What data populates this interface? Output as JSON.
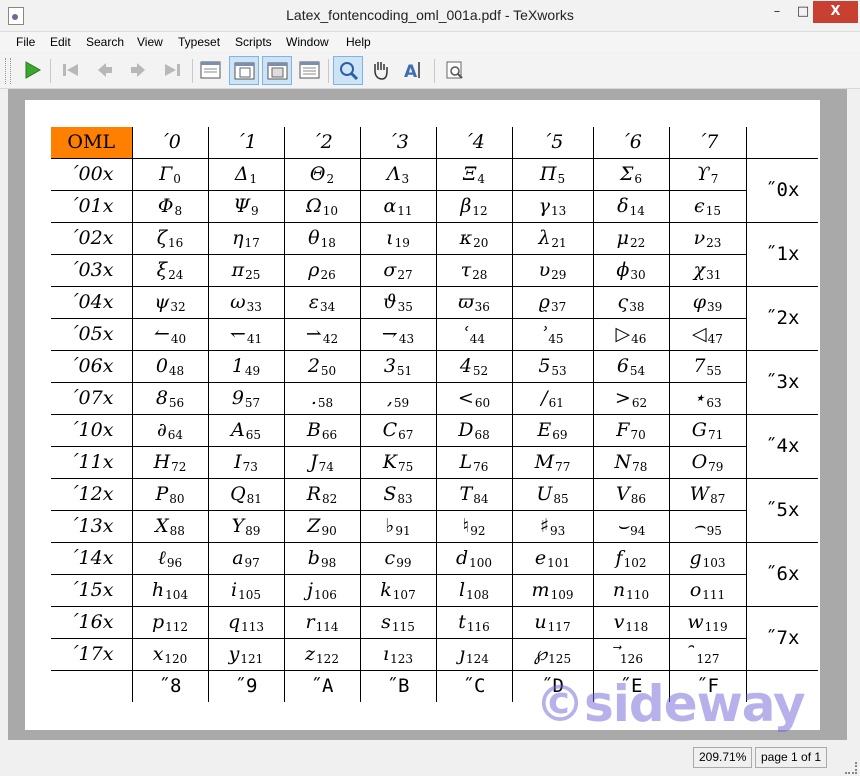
{
  "window": {
    "title": "Latex_fontencoding_oml_001a.pdf - TeXworks",
    "minimize": "–",
    "maximize": "□",
    "close": "X"
  },
  "menu": [
    "File",
    "Edit",
    "Search",
    "View",
    "Typeset",
    "Scripts",
    "Window",
    "Help"
  ],
  "toolbar": [
    {
      "name": "typeset-button",
      "icon": "play-icon",
      "active": false
    },
    {
      "name": "first-page-button",
      "icon": "first-page-icon",
      "active": false
    },
    {
      "name": "previous-page-button",
      "icon": "previous-page-icon",
      "active": false
    },
    {
      "name": "next-page-button",
      "icon": "next-page-icon",
      "active": false
    },
    {
      "name": "last-page-button",
      "icon": "last-page-icon",
      "active": false
    },
    {
      "name": "actual-size-button",
      "icon": "actual-size-icon",
      "active": false
    },
    {
      "name": "fit-width-button",
      "icon": "fit-width-icon",
      "active": true
    },
    {
      "name": "fit-window-button",
      "icon": "fit-window-icon",
      "active": true
    },
    {
      "name": "continuous-scroll-button",
      "icon": "continuous-scroll-icon",
      "active": false
    },
    {
      "name": "magnify-tool-button",
      "icon": "magnifier-icon",
      "active": true
    },
    {
      "name": "scroll-tool-button",
      "icon": "hand-icon",
      "active": false
    },
    {
      "name": "select-text-tool-button",
      "icon": "select-text-icon",
      "active": false
    },
    {
      "name": "select-image-tool-button",
      "icon": "select-image-icon",
      "active": false
    }
  ],
  "table": {
    "corner": "OML",
    "columns": [
      "´0",
      "´1",
      "´2",
      "´3",
      "´4",
      "´5",
      "´6",
      "´7"
    ],
    "footer": [
      "˝8",
      "˝9",
      "˝A",
      "˝B",
      "˝C",
      "˝D",
      "˝E",
      "˝F"
    ],
    "hex_groups": [
      "˝0x",
      "˝1x",
      "˝2x",
      "˝3x",
      "˝4x",
      "˝5x",
      "˝6x",
      "˝7x"
    ],
    "rows": [
      {
        "label": "´00x",
        "cells": [
          {
            "g": "Γ",
            "n": "0"
          },
          {
            "g": "Δ",
            "n": "1"
          },
          {
            "g": "Θ",
            "n": "2"
          },
          {
            "g": "Λ",
            "n": "3"
          },
          {
            "g": "Ξ",
            "n": "4"
          },
          {
            "g": "Π",
            "n": "5"
          },
          {
            "g": "Σ",
            "n": "6"
          },
          {
            "g": "ϒ",
            "n": "7"
          }
        ]
      },
      {
        "label": "´01x",
        "cells": [
          {
            "g": "Φ",
            "n": "8"
          },
          {
            "g": "Ψ",
            "n": "9"
          },
          {
            "g": "Ω",
            "n": "10"
          },
          {
            "g": "α",
            "n": "11"
          },
          {
            "g": "β",
            "n": "12"
          },
          {
            "g": "γ",
            "n": "13"
          },
          {
            "g": "δ",
            "n": "14"
          },
          {
            "g": "ϵ",
            "n": "15"
          }
        ]
      },
      {
        "label": "´02x",
        "cells": [
          {
            "g": "ζ",
            "n": "16"
          },
          {
            "g": "η",
            "n": "17"
          },
          {
            "g": "θ",
            "n": "18"
          },
          {
            "g": "ι",
            "n": "19"
          },
          {
            "g": "κ",
            "n": "20"
          },
          {
            "g": "λ",
            "n": "21"
          },
          {
            "g": "μ",
            "n": "22"
          },
          {
            "g": "ν",
            "n": "23"
          }
        ]
      },
      {
        "label": "´03x",
        "cells": [
          {
            "g": "ξ",
            "n": "24"
          },
          {
            "g": "π",
            "n": "25"
          },
          {
            "g": "ρ",
            "n": "26"
          },
          {
            "g": "σ",
            "n": "27"
          },
          {
            "g": "τ",
            "n": "28"
          },
          {
            "g": "υ",
            "n": "29"
          },
          {
            "g": "ϕ",
            "n": "30"
          },
          {
            "g": "χ",
            "n": "31"
          }
        ]
      },
      {
        "label": "´04x",
        "cells": [
          {
            "g": "ψ",
            "n": "32"
          },
          {
            "g": "ω",
            "n": "33"
          },
          {
            "g": "ε",
            "n": "34"
          },
          {
            "g": "ϑ",
            "n": "35"
          },
          {
            "g": "ϖ",
            "n": "36"
          },
          {
            "g": "ϱ",
            "n": "37"
          },
          {
            "g": "ς",
            "n": "38"
          },
          {
            "g": "φ",
            "n": "39"
          }
        ]
      },
      {
        "label": "´05x",
        "cells": [
          {
            "g": "↼",
            "n": "40"
          },
          {
            "g": "↽",
            "n": "41"
          },
          {
            "g": "⇀",
            "n": "42"
          },
          {
            "g": "⇁",
            "n": "43"
          },
          {
            "g": "ʿ",
            "n": "44"
          },
          {
            "g": "ʾ",
            "n": "45"
          },
          {
            "g": "▷",
            "n": "46"
          },
          {
            "g": "◁",
            "n": "47"
          }
        ]
      },
      {
        "label": "´06x",
        "cells": [
          {
            "g": "0",
            "n": "48"
          },
          {
            "g": "1",
            "n": "49"
          },
          {
            "g": "2",
            "n": "50"
          },
          {
            "g": "3",
            "n": "51"
          },
          {
            "g": "4",
            "n": "52"
          },
          {
            "g": "5",
            "n": "53"
          },
          {
            "g": "6",
            "n": "54"
          },
          {
            "g": "7",
            "n": "55"
          }
        ]
      },
      {
        "label": "´07x",
        "cells": [
          {
            "g": "8",
            "n": "56"
          },
          {
            "g": "9",
            "n": "57"
          },
          {
            "g": ".",
            "n": "58"
          },
          {
            "g": ",",
            "n": "59"
          },
          {
            "g": "<",
            "n": "60"
          },
          {
            "g": "/",
            "n": "61"
          },
          {
            "g": ">",
            "n": "62"
          },
          {
            "g": "⋆",
            "n": "63"
          }
        ]
      },
      {
        "label": "´10x",
        "cells": [
          {
            "g": "∂",
            "n": "64"
          },
          {
            "g": "A",
            "n": "65"
          },
          {
            "g": "B",
            "n": "66"
          },
          {
            "g": "C",
            "n": "67"
          },
          {
            "g": "D",
            "n": "68"
          },
          {
            "g": "E",
            "n": "69"
          },
          {
            "g": "F",
            "n": "70"
          },
          {
            "g": "G",
            "n": "71"
          }
        ]
      },
      {
        "label": "´11x",
        "cells": [
          {
            "g": "H",
            "n": "72"
          },
          {
            "g": "I",
            "n": "73"
          },
          {
            "g": "J",
            "n": "74"
          },
          {
            "g": "K",
            "n": "75"
          },
          {
            "g": "L",
            "n": "76"
          },
          {
            "g": "M",
            "n": "77"
          },
          {
            "g": "N",
            "n": "78"
          },
          {
            "g": "O",
            "n": "79"
          }
        ]
      },
      {
        "label": "´12x",
        "cells": [
          {
            "g": "P",
            "n": "80"
          },
          {
            "g": "Q",
            "n": "81"
          },
          {
            "g": "R",
            "n": "82"
          },
          {
            "g": "S",
            "n": "83"
          },
          {
            "g": "T",
            "n": "84"
          },
          {
            "g": "U",
            "n": "85"
          },
          {
            "g": "V",
            "n": "86"
          },
          {
            "g": "W",
            "n": "87"
          }
        ]
      },
      {
        "label": "´13x",
        "cells": [
          {
            "g": "X",
            "n": "88"
          },
          {
            "g": "Y",
            "n": "89"
          },
          {
            "g": "Z",
            "n": "90"
          },
          {
            "g": "♭",
            "n": "91"
          },
          {
            "g": "♮",
            "n": "92"
          },
          {
            "g": "♯",
            "n": "93"
          },
          {
            "g": "⌣",
            "n": "94"
          },
          {
            "g": "⌢",
            "n": "95"
          }
        ]
      },
      {
        "label": "´14x",
        "cells": [
          {
            "g": "ℓ",
            "n": "96"
          },
          {
            "g": "a",
            "n": "97"
          },
          {
            "g": "b",
            "n": "98"
          },
          {
            "g": "c",
            "n": "99"
          },
          {
            "g": "d",
            "n": "100"
          },
          {
            "g": "e",
            "n": "101"
          },
          {
            "g": "f",
            "n": "102"
          },
          {
            "g": "g",
            "n": "103"
          }
        ]
      },
      {
        "label": "´15x",
        "cells": [
          {
            "g": "h",
            "n": "104"
          },
          {
            "g": "i",
            "n": "105"
          },
          {
            "g": "j",
            "n": "106"
          },
          {
            "g": "k",
            "n": "107"
          },
          {
            "g": "l",
            "n": "108"
          },
          {
            "g": "m",
            "n": "109"
          },
          {
            "g": "n",
            "n": "110"
          },
          {
            "g": "o",
            "n": "111"
          }
        ]
      },
      {
        "label": "´16x",
        "cells": [
          {
            "g": "p",
            "n": "112"
          },
          {
            "g": "q",
            "n": "113"
          },
          {
            "g": "r",
            "n": "114"
          },
          {
            "g": "s",
            "n": "115"
          },
          {
            "g": "t",
            "n": "116"
          },
          {
            "g": "u",
            "n": "117"
          },
          {
            "g": "v",
            "n": "118"
          },
          {
            "g": "w",
            "n": "119"
          }
        ]
      },
      {
        "label": "´17x",
        "cells": [
          {
            "g": "x",
            "n": "120"
          },
          {
            "g": "y",
            "n": "121"
          },
          {
            "g": "z",
            "n": "122"
          },
          {
            "g": "ı",
            "n": "123"
          },
          {
            "g": "ȷ",
            "n": "124"
          },
          {
            "g": "℘",
            "n": "125"
          },
          {
            "g": "⃗",
            "n": "126"
          },
          {
            "g": "̑",
            "n": "127"
          }
        ]
      }
    ]
  },
  "watermark": "©sideway",
  "status": {
    "zoom": "209.71%",
    "page": "page 1 of 1"
  }
}
